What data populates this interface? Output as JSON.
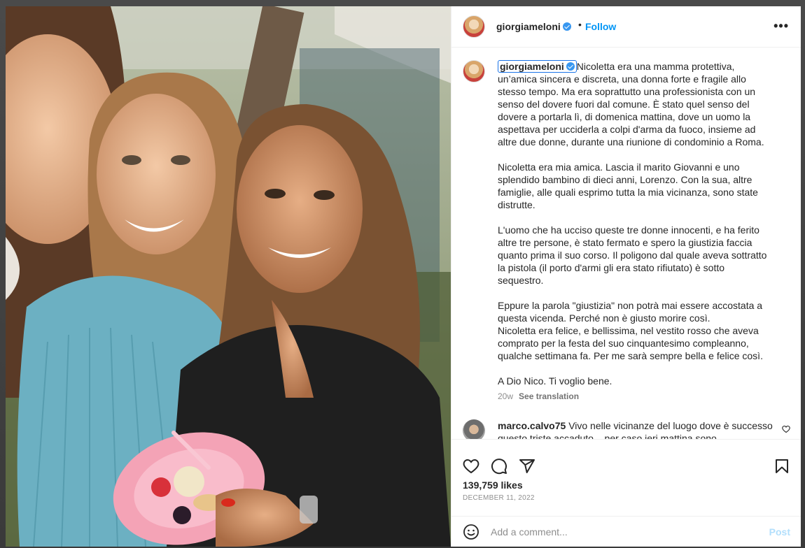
{
  "post": {
    "username": "giorgiameloni",
    "follow_label": "Follow",
    "separator": "•",
    "more_label": "•••"
  },
  "caption": {
    "username": "giorgiameloni",
    "text": "Nicoletta era una mamma protettiva,\nun’amica sincera e discreta, una donna forte e fragile allo\nstesso tempo. Ma era soprattutto una professionista con un\nsenso del dovere fuori dal comune. È stato quel senso del\ndovere a portarla lì, di domenica mattina, dove un uomo la\naspettava per ucciderla a colpi d'arma da fuoco, insieme ad\naltre due donne, durante una riunione di condominio a Roma.\n\nNicoletta era mia amica. Lascia il marito Giovanni e uno\nsplendido bambino di dieci anni, Lorenzo. Con la sua, altre\nfamiglie, alle quali esprimo tutta la mia vicinanza, sono state\ndistrutte.\n\nL'uomo che ha ucciso queste tre donne innocenti, e ha ferito\naltre tre persone, è stato fermato e spero la giustizia faccia\nquanto prima il suo corso. Il poligono dal quale aveva sottratto\nla pistola (il porto d'armi gli era stato rifiutato) è sotto\nsequestro.\n\nEppure la parola \"giustizia\" non potrà mai essere accostata a\nquesta vicenda. Perché non è giusto morire così.\nNicoletta era felice, e bellissima, nel vestito rosso che aveva\ncomprato per la festa del suo cinquantesimo compleanno,\nqualche settimana fa. Per me sarà sempre bella e felice così.\n\nA Dio Nico. Ti voglio bene.",
    "age": "20w",
    "see_translation": "See translation"
  },
  "comment": {
    "username": "marco.calvo75",
    "text": "Vivo nelle vicinanze del luogo dove è successo questo triste accaduto... per caso ieri mattina sono"
  },
  "stats": {
    "likes": "139,759 likes",
    "date": "DECEMBER 11, 2022"
  },
  "add_comment": {
    "placeholder": "Add a comment...",
    "post_label": "Post"
  },
  "icons": {
    "like": "heart-icon",
    "comment": "comment-bubble-icon",
    "share": "paper-plane-icon",
    "save": "bookmark-icon",
    "emoji": "smiley-icon",
    "verified": "verified-badge-icon"
  },
  "colors": {
    "accent": "#0095f6",
    "verified": "#3897f0",
    "post_disabled": "#b2dffc",
    "nail_polish": "#d92a1c",
    "plate": "#f4a3b6"
  }
}
